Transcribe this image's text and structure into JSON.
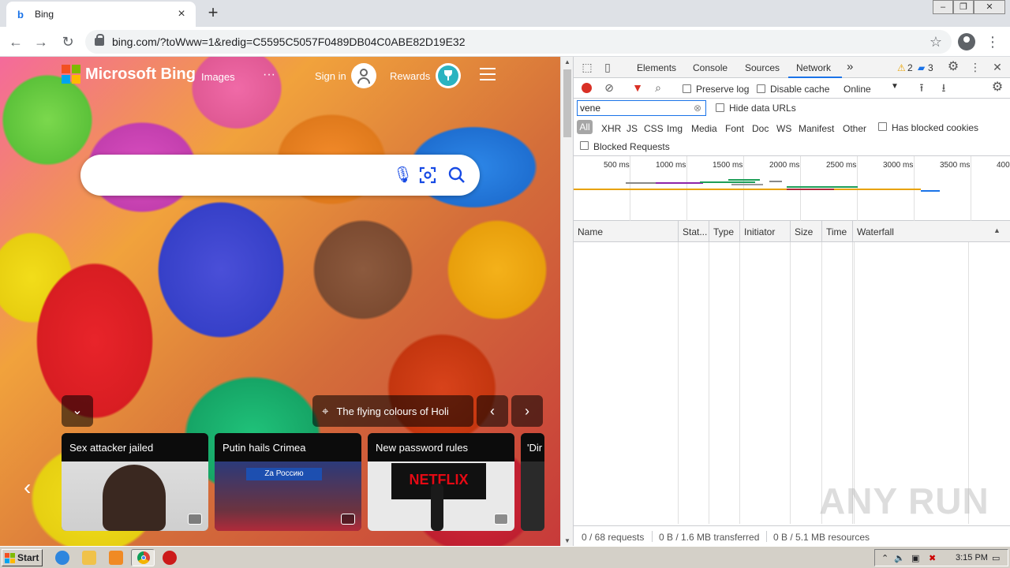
{
  "browser": {
    "tab_title": "Bing",
    "tab_favicon": "b",
    "new_tab": "+",
    "url": "bing.com/?toWww=1&redig=C5595C5057F0489DB04C0ABE82D19E32",
    "window_controls": [
      "‒",
      "❐",
      "✕"
    ]
  },
  "bing": {
    "logo_text": "Microsoft Bing",
    "nav_images": "Images",
    "nav_more": "···",
    "sign_in": "Sign in",
    "rewards": "Rewards",
    "caption": "The flying colours of Holi",
    "cards": [
      {
        "title": "Sex attacker jailed"
      },
      {
        "title": "Putin hails Crimea",
        "banner": "Za Россию"
      },
      {
        "title": "New password rules",
        "logo": "NETFLIX"
      },
      {
        "title": "'Dir"
      }
    ]
  },
  "devtools": {
    "tabs": [
      "Elements",
      "Console",
      "Sources",
      "Network"
    ],
    "active_tab": "Network",
    "more_tabs": "»",
    "warnings": "2",
    "messages": "3",
    "preserve_log": "Preserve log",
    "disable_cache": "Disable cache",
    "throttle": "Online",
    "filter_value": "vene",
    "hide_data_urls": "Hide data URLs",
    "filter_types": [
      "All",
      "XHR",
      "JS",
      "CSS",
      "Img",
      "Media",
      "Font",
      "Doc",
      "WS",
      "Manifest",
      "Other"
    ],
    "has_blocked_cookies": "Has blocked cookies",
    "blocked_requests": "Blocked Requests",
    "timeline_ticks": [
      "500 ms",
      "1000 ms",
      "1500 ms",
      "2000 ms",
      "2500 ms",
      "3000 ms",
      "3500 ms",
      "400"
    ],
    "columns": [
      "Name",
      "Stat...",
      "Type",
      "Initiator",
      "Size",
      "Time",
      "Waterfall"
    ],
    "status": {
      "requests": "0 / 68 requests",
      "transferred": "0 B / 1.6 MB transferred",
      "resources": "0 B / 5.1 MB resources"
    }
  },
  "watermark": "ANY RUN",
  "taskbar": {
    "start": "Start",
    "clock": "3:15 PM"
  },
  "colors": {
    "accent": "#1a73e8",
    "record": "#d93025",
    "bing_blue": "#174ae4"
  }
}
